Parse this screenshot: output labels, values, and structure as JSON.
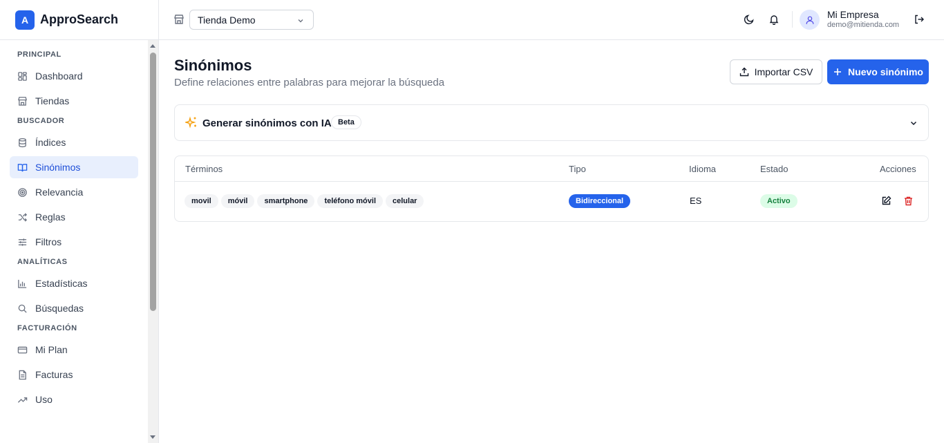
{
  "app": {
    "logo_letter": "A",
    "name": "ApproSearch"
  },
  "sidebar": {
    "sections": [
      {
        "title": "PRINCIPAL",
        "items": [
          {
            "label": "Dashboard",
            "icon": "dashboard-icon"
          },
          {
            "label": "Tiendas",
            "icon": "store-icon"
          }
        ]
      },
      {
        "title": "BUSCADOR",
        "items": [
          {
            "label": "Índices",
            "icon": "database-icon"
          },
          {
            "label": "Sinónimos",
            "icon": "book-icon",
            "active": true
          },
          {
            "label": "Relevancia",
            "icon": "target-icon"
          },
          {
            "label": "Reglas",
            "icon": "shuffle-icon"
          },
          {
            "label": "Filtros",
            "icon": "sliders-icon"
          }
        ]
      },
      {
        "title": "ANALÍTICAS",
        "items": [
          {
            "label": "Estadísticas",
            "icon": "bar-chart-icon"
          },
          {
            "label": "Búsquedas",
            "icon": "search-icon"
          }
        ]
      },
      {
        "title": "FACTURACIÓN",
        "items": [
          {
            "label": "Mi Plan",
            "icon": "credit-card-icon"
          },
          {
            "label": "Facturas",
            "icon": "file-icon"
          },
          {
            "label": "Uso",
            "icon": "trending-up-icon"
          }
        ]
      }
    ]
  },
  "header": {
    "store_select": "Tienda Demo",
    "user_name": "Mi Empresa",
    "user_email": "demo@mitienda.com"
  },
  "page": {
    "title": "Sinónimos",
    "subtitle": "Define relaciones entre palabras para mejorar la búsqueda",
    "import_label": "Importar CSV",
    "new_label": "Nuevo sinónimo"
  },
  "ai": {
    "title": "Generar sinónimos con IA",
    "badge": "Beta"
  },
  "table": {
    "headers": {
      "terms": "Términos",
      "type": "Tipo",
      "language": "Idioma",
      "status": "Estado",
      "actions": "Acciones"
    },
    "rows": [
      {
        "terms": [
          "movil",
          "móvil",
          "smartphone",
          "teléfono móvil",
          "celular"
        ],
        "type": "Bidireccional",
        "language": "ES",
        "status": "Activo"
      }
    ]
  },
  "colors": {
    "primary": "#2563eb",
    "active_bg": "#e8effd",
    "status_green": "#15803d",
    "danger": "#dc2626",
    "ai_accent": "#f59e0b"
  }
}
